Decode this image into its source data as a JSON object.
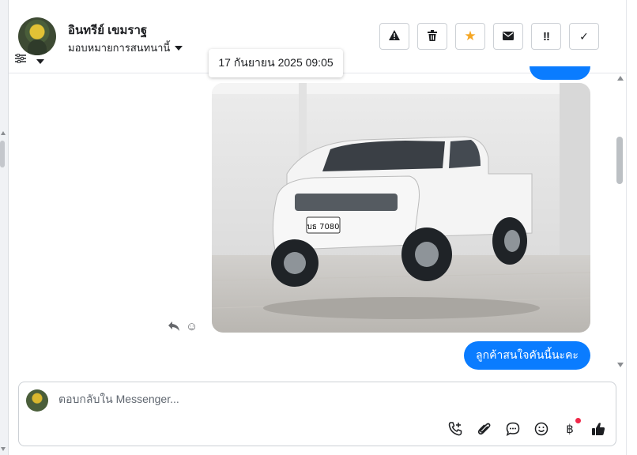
{
  "contact": {
    "name": "อินทรีย์ เขมราฐ",
    "assignment": "มอบหมายการสนทนานี้"
  },
  "header_actions": [
    {
      "icon": "warning-icon",
      "symbol": "⚠"
    },
    {
      "icon": "trash-icon",
      "symbol": "🗑"
    },
    {
      "icon": "star-icon",
      "symbol": "★"
    },
    {
      "icon": "mail-icon",
      "symbol": "✉"
    },
    {
      "icon": "priority-icon",
      "symbol": "!!"
    },
    {
      "icon": "check-icon",
      "symbol": "✓"
    }
  ],
  "tooltip": {
    "timestamp": "17 กันยายน 2025 09:05"
  },
  "messages": {
    "photo_plate": "บธ 7080",
    "text": "ลูกค้าสนใจคันนี้นะคะ"
  },
  "composer": {
    "placeholder": "ตอบกลับใน Messenger..."
  },
  "colors": {
    "accent": "#0a7cff",
    "star": "#f5a623",
    "notification": "#f02849"
  }
}
